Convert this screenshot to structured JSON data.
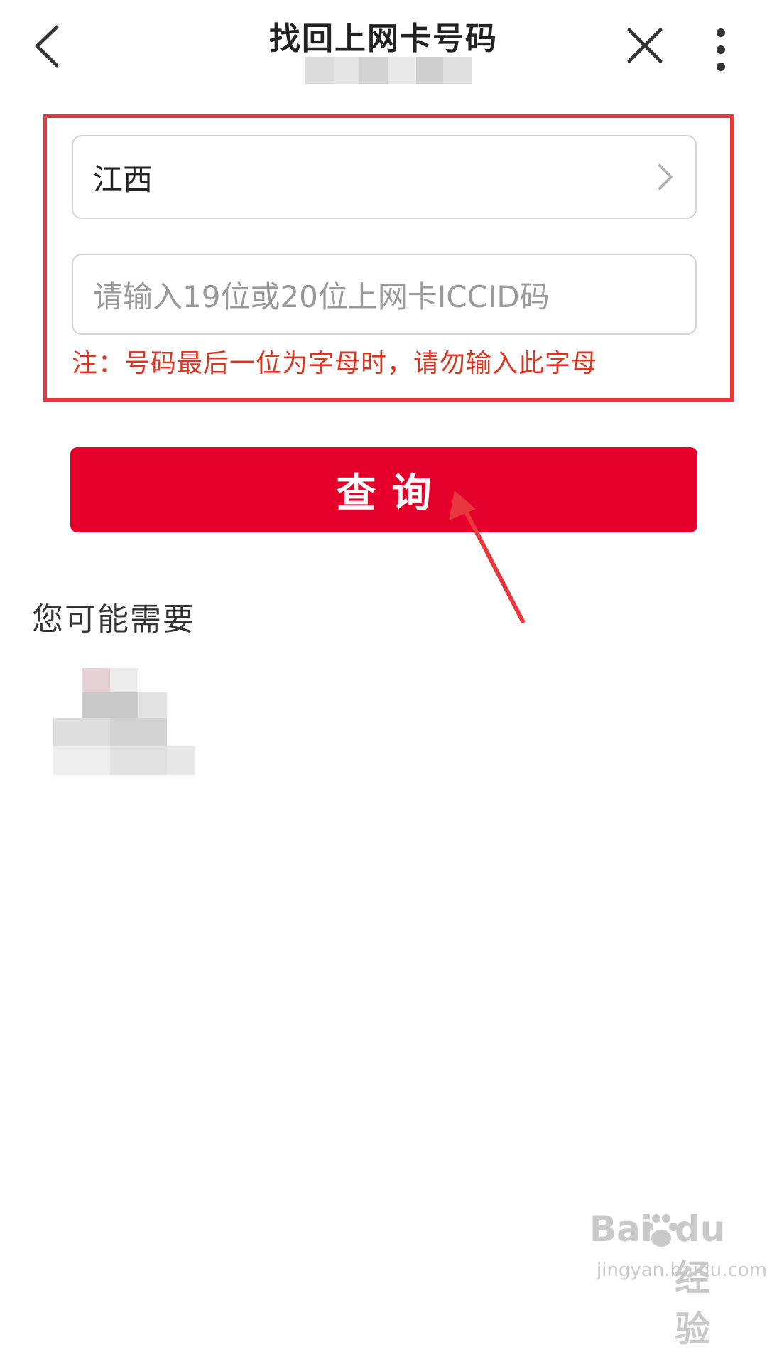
{
  "header": {
    "title": "找回上网卡号码"
  },
  "form": {
    "province_value": "江西",
    "iccid_placeholder": "请输入19位或20位上网卡ICCID码",
    "note": "注：号码最后一位为字母时，请勿输入此字母"
  },
  "actions": {
    "query_label": "查询"
  },
  "recommendations": {
    "heading": "您可能需要"
  },
  "watermark": {
    "logo_text": "Bai",
    "logo_text2": "du",
    "product": "经验",
    "url": "jingyan.baidu.com"
  },
  "colors": {
    "primary_red": "#e4002b",
    "note_red": "#e0341f",
    "annotation_red": "#e8383d"
  },
  "icons": [
    "back-arrow-icon",
    "close-icon",
    "more-vertical-icon",
    "chevron-right-icon"
  ]
}
